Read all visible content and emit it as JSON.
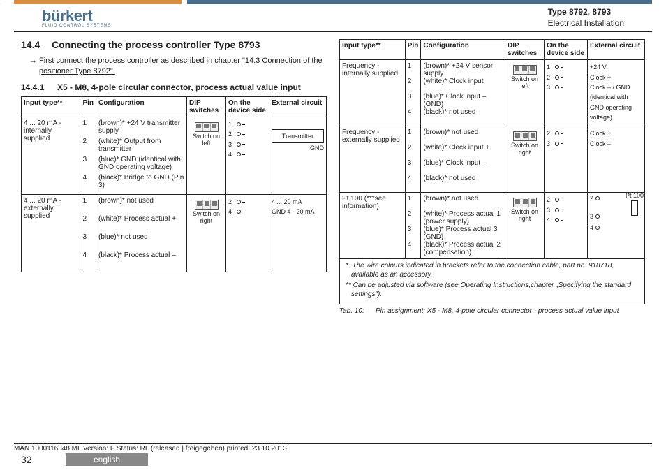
{
  "header": {
    "logo_main": "bürkert",
    "logo_sub": "FLUID CONTROL SYSTEMS",
    "type": "Type 8792, 8793",
    "section": "Electrical Installation"
  },
  "h2_num": "14.4",
  "h2_text": "Connecting the process controller Type 8793",
  "intro_lead": "First connect the process controller as described in chapter ",
  "intro_link": "\"14.3 Connection of the positioner Type 8792\".",
  "h3_num": "14.4.1",
  "h3_text": "X5 - M8, 4-pole circular connector, process actual value input",
  "thead": {
    "c1": "Input type**",
    "c2": "Pin",
    "c3": "Configuration",
    "c4": "DIP switches",
    "c5": "On the device side",
    "c6": "External circuit"
  },
  "table1": [
    {
      "type": "4 ... 20 mA - internally supplied",
      "rows": [
        {
          "pin": "1",
          "conf": "(brown)* +24 V transmitter supply"
        },
        {
          "pin": "2",
          "conf": "(white)* Output from transmitter"
        },
        {
          "pin": "3",
          "conf": "(blue)* GND (identical with GND operating voltage)"
        },
        {
          "pin": "4",
          "conf": "(black)* Bridge to GND (Pin 3)"
        }
      ],
      "switch_pos": "left",
      "switch_label": "Switch on left",
      "dev": [
        "1",
        "2",
        "3",
        "4"
      ],
      "ext_box": "Transmitter",
      "ext_gnd": "GND"
    },
    {
      "type": "4 ... 20 mA - externally supplied",
      "rows": [
        {
          "pin": "1",
          "conf": "(brown)* not used"
        },
        {
          "pin": "2",
          "conf": "(white)* Process actual +"
        },
        {
          "pin": "3",
          "conf": "(blue)* not used"
        },
        {
          "pin": "4",
          "conf": "(black)* Process actual –"
        }
      ],
      "switch_pos": "right",
      "switch_label": "Switch on right",
      "dev": [
        "2",
        "4"
      ],
      "ext_lines": [
        "4 ... 20 mA",
        "GND 4 - 20 mA"
      ]
    }
  ],
  "table2": [
    {
      "type": "Frequency -internally supplied",
      "rows": [
        {
          "pin": "1",
          "conf": "(brown)* +24 V sensor supply"
        },
        {
          "pin": "2",
          "conf": "(white)* Clock input"
        },
        {
          "pin": "3",
          "conf": "(blue)* Clock input – (GND)"
        },
        {
          "pin": "4",
          "conf": "(black)* not used"
        }
      ],
      "switch_pos": "left",
      "switch_label": "Switch on left",
      "dev": [
        "1",
        "2",
        "3"
      ],
      "ext_lines": [
        "+24 V",
        "Clock +",
        "Clock – / GND (identical with GND operating voltage)"
      ]
    },
    {
      "type": "Frequency - externally supplied",
      "rows": [
        {
          "pin": "1",
          "conf": "(brown)* not used"
        },
        {
          "pin": "2",
          "conf": "(white)* Clock input +"
        },
        {
          "pin": "3",
          "conf": "(blue)* Clock input –"
        },
        {
          "pin": "4",
          "conf": "(black)* not used"
        }
      ],
      "switch_pos": "right",
      "switch_label": "Switch on right",
      "dev": [
        "2",
        "3"
      ],
      "ext_lines": [
        "Clock +",
        "Clock –"
      ]
    },
    {
      "type": "Pt 100 (***see information)",
      "rows": [
        {
          "pin": "1",
          "conf": "(brown)* not used"
        },
        {
          "pin": "2",
          "conf": "(white)* Process actual 1 (power supply)"
        },
        {
          "pin": "3",
          "conf": "(blue)* Process actual 3 (GND)"
        },
        {
          "pin": "4",
          "conf": "(black)* Process actual 2 (compensation)"
        }
      ],
      "switch_pos": "right",
      "switch_label": "Switch on right",
      "dev": [
        "2",
        "3",
        "4"
      ],
      "ext_box": "Pt 100"
    }
  ],
  "footnote1": "The wire colours indicated in brackets refer to the connection cable, part no. 918718, available as an accessory.",
  "footnote2": "Can be adjusted via software (see Operating Instructions,chapter „Specifying the standard settings\").",
  "tab_label": "Tab. 10:",
  "tab_caption": "Pin assignment; X5 - M8, 4-pole circular connector - process actual value input",
  "manline": "MAN 1000116348 ML Version: F Status: RL (released | freigegeben) printed: 23.10.2013",
  "pagenum": "32",
  "lang": "english"
}
